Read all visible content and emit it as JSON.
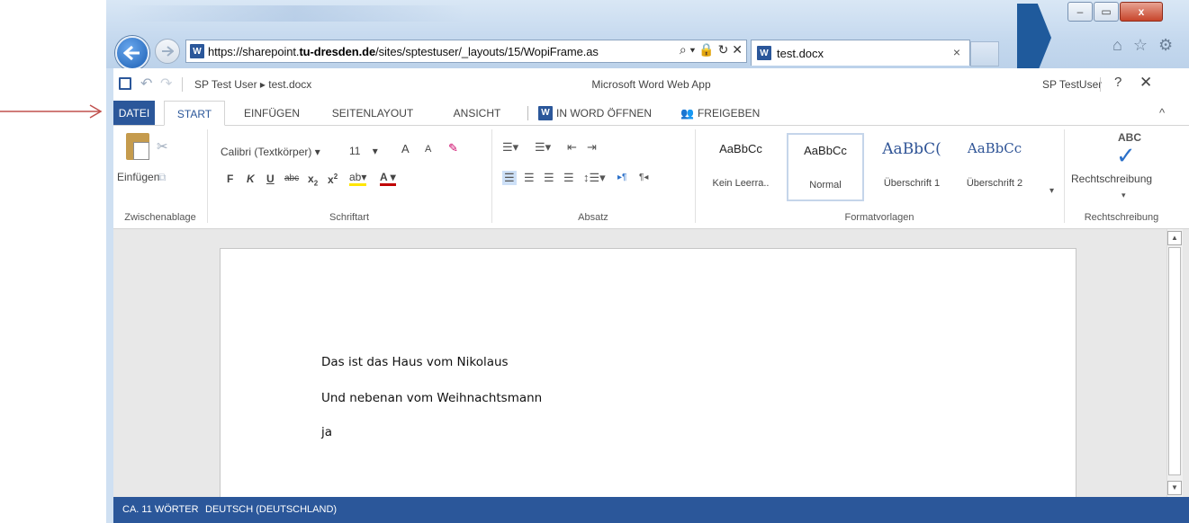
{
  "annotation": {
    "arrow_color": "#c0504d"
  },
  "browser": {
    "url_prefix": "https://sharepoint.",
    "url_host": "tu-dresden.de",
    "url_suffix": "/sites/sptestuser/_layouts/15/WopiFrame.as",
    "url_icons": "⌕ ▾ 🔒 ↻ ✕",
    "tab_title": "test.docx",
    "tab_close": "×",
    "window_buttons": {
      "minimize": "–",
      "maximize": "▭",
      "close": "x"
    },
    "toolbar_icons": [
      "home-icon",
      "star-icon",
      "gear-icon"
    ],
    "toolbar_glyphs": [
      "⌂",
      "☆",
      "⚙"
    ]
  },
  "app": {
    "breadcrumb": "SP Test User  ▸  test.docx",
    "title": "Microsoft Word Web App",
    "user": "SP TestUser",
    "help": "?",
    "close": "✕",
    "accent": "#2b579a"
  },
  "tabs": {
    "file": "DATEI",
    "start": "START",
    "insert": "EINFÜGEN",
    "layout": "SEITENLAYOUT",
    "view": "ANSICHT",
    "open_in_word": "IN WORD ÖFFNEN",
    "share": "FREIGEBEN",
    "collapse": "^"
  },
  "ribbon": {
    "clipboard": {
      "paste": "Einfügen",
      "label": "Zwischenablage"
    },
    "font": {
      "name": "Calibri (Textkörper)",
      "size": "11",
      "grow": "A",
      "shrink": "A",
      "bold": "F",
      "italic": "K",
      "underline": "U",
      "strike": "abc",
      "sub": "x",
      "sup": "x",
      "font_color": "A",
      "label": "Schriftart"
    },
    "paragraph": {
      "label": "Absatz"
    },
    "styles": {
      "items": [
        {
          "sample": "AaBbCc",
          "name": "Kein Leerra.."
        },
        {
          "sample": "AaBbCc",
          "name": "Normal"
        },
        {
          "sample": "AaBbC(",
          "name": "Überschrift 1"
        },
        {
          "sample": "AaBbCc",
          "name": "Überschrift 2"
        }
      ],
      "label": "Formatvorlagen"
    },
    "spelling": {
      "abc": "ABC",
      "button": "Rechtschreibung",
      "label": "Rechtschreibung"
    }
  },
  "document": {
    "paragraphs": [
      "Das ist das Haus vom Nikolaus",
      "Und nebenan vom Weihnachtsmann",
      "ja"
    ]
  },
  "status": {
    "words": "CA. 11 WÖRTER",
    "language": "DEUTSCH (DEUTSCHLAND)"
  }
}
